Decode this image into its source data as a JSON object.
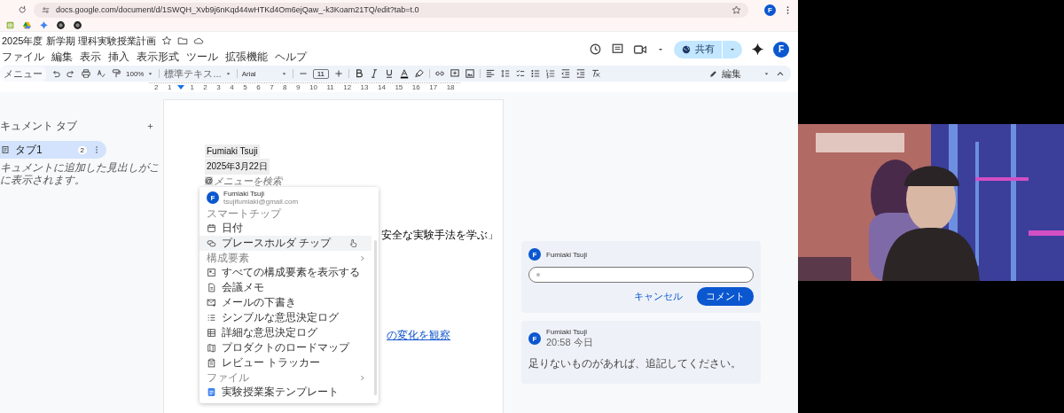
{
  "browser": {
    "url": "docs.google.com/document/d/1SWQH_Xvb9j6nKqd44wHTKd4Om6ejQaw_-k3Koam21TQ/edit?tab=t.0",
    "profile": "F"
  },
  "doc_header": {
    "title": "2025年度 新学期 理科実験授業計画",
    "menu": [
      "ファイル",
      "編集",
      "表示",
      "挿入",
      "表示形式",
      "ツール",
      "拡張機能",
      "ヘルプ"
    ],
    "share": "共有",
    "account": "F"
  },
  "toolbar": {
    "menu_search": "メニュー",
    "zoom": "100%",
    "style": "標準テキス...",
    "font": "Arial",
    "size": "11",
    "mode": "編集"
  },
  "ruler": {
    "ticks": [
      "2",
      "1",
      "1",
      "2",
      "3",
      "4",
      "5",
      "6",
      "7",
      "8",
      "9",
      "10",
      "11",
      "12",
      "13",
      "14",
      "15",
      "16",
      "17",
      "18"
    ]
  },
  "sidebar": {
    "title": "キュメント タブ",
    "tabs": [
      {
        "label": "タブ1",
        "count": "2",
        "selected": true
      }
    ],
    "hint": [
      "キュメントに追加した見出しがこ",
      "に表示されます。"
    ]
  },
  "document": {
    "chips": [
      "Fumiaki Tsuji",
      "2025年3月22日"
    ],
    "at": "@",
    "search_placeholder": "メニューを検索",
    "partial_text": "安全な実験手法を学ぶ」",
    "partial_link": "の変化を観察"
  },
  "insert_menu": {
    "person": {
      "avatar": "F",
      "name": "Fumiaki Tsuji",
      "email": "tsujifumiaki@gmail.com"
    },
    "sections": [
      {
        "heading": "スマートチップ",
        "submenu": false,
        "items": [
          {
            "kind": "calendar",
            "label": "日付",
            "selected": false
          },
          {
            "kind": "chip",
            "label": "プレースホルダ チップ",
            "selected": true
          }
        ]
      },
      {
        "heading": "構成要素",
        "submenu": true,
        "items": [
          {
            "kind": "blocks",
            "label": "すべての構成要素を表示する",
            "selected": false
          },
          {
            "kind": "doc",
            "label": "会議メモ",
            "selected": false
          },
          {
            "kind": "mail",
            "label": "メールの下書き",
            "selected": false
          },
          {
            "kind": "list",
            "label": "シンプルな意思決定ログ",
            "selected": false
          },
          {
            "kind": "table",
            "label": "詳細な意思決定ログ",
            "selected": false
          },
          {
            "kind": "map",
            "label": "プロダクトのロードマップ",
            "selected": false
          },
          {
            "kind": "clipboard",
            "label": "レビュー トラッカー",
            "selected": false
          }
        ]
      },
      {
        "heading": "ファイル",
        "submenu": true,
        "items": [
          {
            "kind": "docfile",
            "label": "実験授業案テンプレート",
            "selected": false
          }
        ]
      }
    ]
  },
  "comments": [
    {
      "kind": "draft",
      "avatar": "F",
      "author": "Fumiaki Tsuji",
      "cancel": "キャンセル",
      "submit": "コメント"
    },
    {
      "kind": "posted",
      "avatar": "F",
      "author": "Fumiaki Tsuji",
      "time": "20:58 今日",
      "text": "足りないものがあれば、追記してください。"
    }
  ]
}
